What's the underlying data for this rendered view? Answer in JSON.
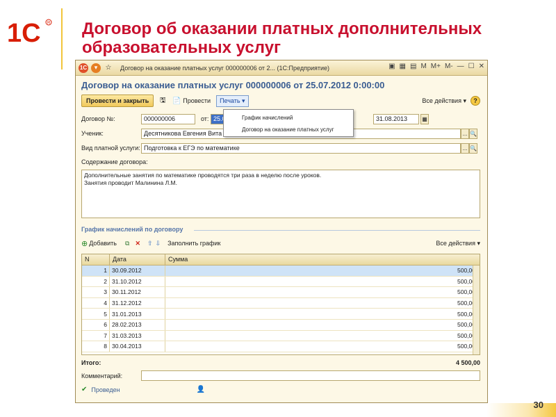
{
  "slide": {
    "title": "Договор об оказании платных дополнительных образовательных услуг",
    "page_number": "30"
  },
  "window": {
    "title": "Договор на оказание платных услуг 000000006 от 2... (1С:Предприятие)",
    "doc_header": "Договор на оказание платных услуг 000000006 от 25.07.2012 0:00:00",
    "toolbar": {
      "post_close": "Провести и закрыть",
      "post": "Провести",
      "print": "Печать",
      "all_actions": "Все действия"
    },
    "print_menu": [
      "График начислений",
      "Договор на оказание платных услуг"
    ],
    "fields": {
      "contract_no_label": "Договор №:",
      "contract_no": "000000006",
      "from_label": "от:",
      "from_value": "25.0",
      "to_value": "31.08.2013",
      "student_label": "Ученик:",
      "student": "Десятникова Евгения Вита",
      "service_label": "Вид платной услуги:",
      "service": "Подготовка к ЕГЭ по математике",
      "content_label": "Содержание договора:",
      "content_line1": "Дополнительные занятия по математике проводятся три раза в неделю после уроков.",
      "content_line2": "Занятия проводит Малинина Л.М."
    },
    "schedule": {
      "title": "График начислений по договору",
      "add": "Добавить",
      "fill": "Заполнить график",
      "all_actions": "Все действия",
      "columns": [
        "N",
        "Дата",
        "Сумма"
      ],
      "rows": [
        {
          "n": "1",
          "date": "30.09.2012",
          "sum": "500,00"
        },
        {
          "n": "2",
          "date": "31.10.2012",
          "sum": "500,00"
        },
        {
          "n": "3",
          "date": "30.11.2012",
          "sum": "500,00"
        },
        {
          "n": "4",
          "date": "31.12.2012",
          "sum": "500,00"
        },
        {
          "n": "5",
          "date": "31.01.2013",
          "sum": "500,00"
        },
        {
          "n": "6",
          "date": "28.02.2013",
          "sum": "500,00"
        },
        {
          "n": "7",
          "date": "31.03.2013",
          "sum": "500,00"
        },
        {
          "n": "8",
          "date": "30.04.2013",
          "sum": "500,00"
        }
      ]
    },
    "total_label": "Итого:",
    "total_value": "4 500,00",
    "comment_label": "Комментарий:",
    "status": "Проведен"
  }
}
